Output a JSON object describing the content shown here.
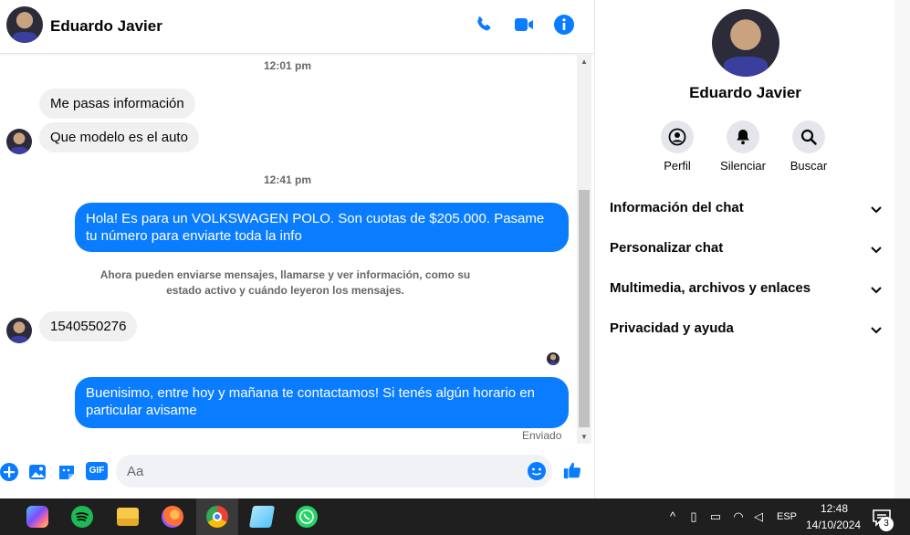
{
  "header": {
    "contact_name": "Eduardo Javier"
  },
  "messages": {
    "ts1": "12:01 pm",
    "in1": "Me pasas información",
    "in2": "Que modelo es el auto",
    "ts2": "12:41 pm",
    "out1": "Hola! Es para un VOLKSWAGEN POLO. Son cuotas de $205.000. Pasame tu número para enviarte toda la info",
    "notice": "Ahora pueden enviarse mensajes, llamarse y ver información, como su estado activo y cuándo leyeron los mensajes.",
    "in3": "1540550276",
    "out2": "Buenisimo, entre hoy y mañana te contactamos! Si tenés algún horario en particular avisame",
    "sent_status": "Enviado"
  },
  "composer": {
    "placeholder": "Aa",
    "gif_label": "GIF"
  },
  "side": {
    "name": "Eduardo Javier",
    "actions": [
      {
        "label": "Perfil"
      },
      {
        "label": "Silenciar"
      },
      {
        "label": "Buscar"
      }
    ],
    "sections": [
      {
        "label": "Información del chat"
      },
      {
        "label": "Personalizar chat"
      },
      {
        "label": "Multimedia, archivos y enlaces"
      },
      {
        "label": "Privacidad y ayuda"
      }
    ]
  },
  "taskbar": {
    "lang": "ESP",
    "time": "12:48",
    "date": "14/10/2024",
    "notif_count": "3"
  },
  "colors": {
    "accent": "#0a7cff",
    "incoming_bubble": "#f0f0f0",
    "taskbar": "#1f1f1f"
  }
}
